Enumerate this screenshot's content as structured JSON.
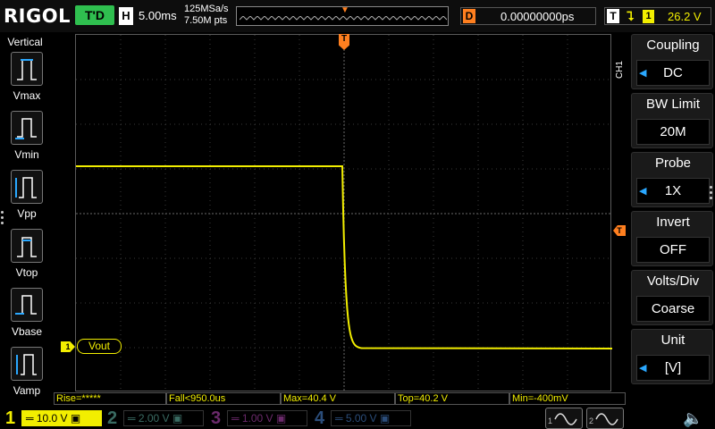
{
  "brand": "RIGOL",
  "run_status": "T'D",
  "horizontal": {
    "tag": "H",
    "timebase": "5.00ms"
  },
  "sampling": {
    "rate": "125MSa/s",
    "points": "7.50M pts"
  },
  "delay": {
    "tag": "D",
    "value": "0.00000000ps"
  },
  "trigger": {
    "tag": "T",
    "edge_glyph": "⮧",
    "source": "1",
    "level": "26.2 V"
  },
  "left_menu": {
    "title": "Vertical",
    "items": [
      {
        "label": "Vmax",
        "icon": "vmax-icon"
      },
      {
        "label": "Vmin",
        "icon": "vmin-icon"
      },
      {
        "label": "Vpp",
        "icon": "vpp-icon"
      },
      {
        "label": "Vtop",
        "icon": "vtop-icon"
      },
      {
        "label": "Vbase",
        "icon": "vbase-icon"
      },
      {
        "label": "Vamp",
        "icon": "vamp-icon"
      }
    ]
  },
  "markers": {
    "trigger_position": "T",
    "trigger_level": "T",
    "ch1": "1"
  },
  "channel_label": "Vout",
  "right_menu": {
    "channel": "CH1",
    "items": [
      {
        "title": "Coupling",
        "value": "DC",
        "has_arrow": true
      },
      {
        "title": "BW Limit",
        "value": "20M",
        "has_arrow": false
      },
      {
        "title": "Probe",
        "value": "1X",
        "has_arrow": true
      },
      {
        "title": "Invert",
        "value": "OFF",
        "has_arrow": false
      },
      {
        "title": "Volts/Div",
        "value": "Coarse",
        "has_arrow": false
      },
      {
        "title": "Unit",
        "value": "[V]",
        "has_arrow": true
      }
    ]
  },
  "measurements": {
    "rise": "Rise=*****",
    "fall": "Fall<950.0us",
    "max": "Max=40.4 V",
    "top": "Top=40.2 V",
    "min": "Min=-400mV"
  },
  "channels": [
    {
      "num": "1",
      "scale": "10.0 V",
      "active": true
    },
    {
      "num": "2",
      "scale": "2.00 V",
      "active": false
    },
    {
      "num": "3",
      "scale": "1.00 V",
      "active": false
    },
    {
      "num": "4",
      "scale": "5.00 V",
      "active": false
    }
  ],
  "generators": [
    "1",
    "2"
  ],
  "colors": {
    "ch1": "#f2ee00",
    "ch2": "#3a6b62",
    "ch3": "#6b2a6b",
    "ch4": "#2b4d7a",
    "trigger": "#ff7f1f",
    "run": "#2fbf4f",
    "menu_arrow": "#2aa8ff"
  },
  "waveform": {
    "volts_per_div": 10,
    "time_per_div_ms": 5,
    "high_level_V": 40.4,
    "low_level_V": -0.4,
    "fall_time_div": 0
  }
}
